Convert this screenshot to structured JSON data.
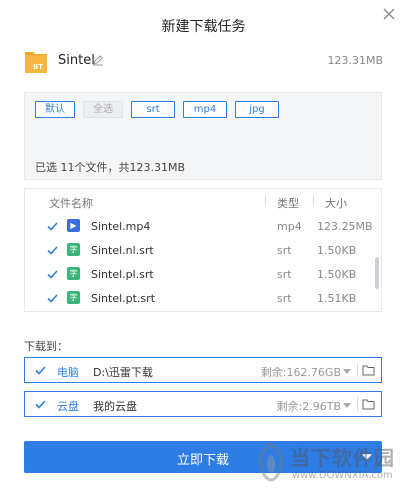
{
  "dialog": {
    "title": "新建下载任务"
  },
  "file": {
    "name": "Sintel",
    "total_size": "123.31MB"
  },
  "filters": [
    {
      "label": "默认",
      "active": true
    },
    {
      "label": "全选",
      "active": false
    },
    {
      "label": "srt",
      "active": true
    },
    {
      "label": "mp4",
      "active": true
    },
    {
      "label": "jpg",
      "active": true
    }
  ],
  "summary": "已选 11个文件，共123.31MB",
  "list": {
    "headers": {
      "name": "文件名称",
      "type": "类型",
      "size": "大小"
    },
    "rows": [
      {
        "name": "Sintel.mp4",
        "type": "mp4",
        "size": "123.25MB",
        "icon": "video-file-icon",
        "glyph": "▶"
      },
      {
        "name": "Sintel.nl.srt",
        "type": "srt",
        "size": "1.50KB",
        "icon": "subtitle-file-icon",
        "glyph": "字"
      },
      {
        "name": "Sintel.pl.srt",
        "type": "srt",
        "size": "1.50KB",
        "icon": "subtitle-file-icon",
        "glyph": "字"
      },
      {
        "name": "Sintel.pt.srt",
        "type": "srt",
        "size": "1.51KB",
        "icon": "subtitle-file-icon",
        "glyph": "字"
      }
    ]
  },
  "download_to": {
    "label": "下载到：",
    "targets": [
      {
        "name": "电脑",
        "path": "D:\\迅雷下载",
        "free": "剩余:162.76GB"
      },
      {
        "name": "云盘",
        "path": "我的云盘",
        "free": "剩余:2.96TB"
      }
    ]
  },
  "actions": {
    "download": "立即下载"
  },
  "watermark": {
    "text": "当下软件园",
    "url": "www.DOWNXIA.com"
  },
  "colors": {
    "accent": "#2e7de4",
    "video_icon": "#3b6fe0",
    "subtitle_icon": "#3ab776",
    "bt_folder": "#f5a623"
  }
}
